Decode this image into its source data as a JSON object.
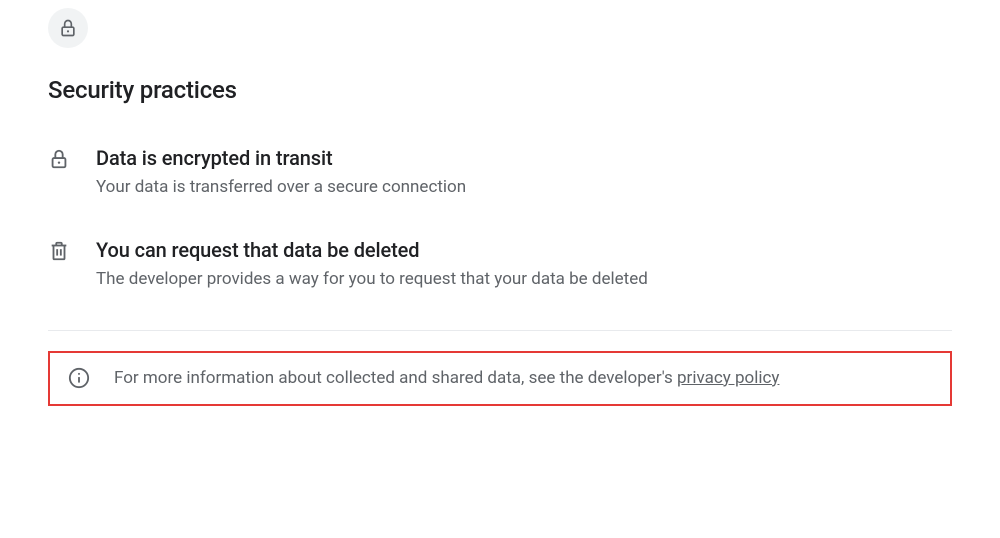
{
  "section": {
    "title": "Security practices"
  },
  "practices": [
    {
      "title": "Data is encrypted in transit",
      "description": "Your data is transferred over a secure connection"
    },
    {
      "title": "You can request that data be deleted",
      "description": "The developer provides a way for you to request that your data be deleted"
    }
  ],
  "info": {
    "text_prefix": "For more information about collected and shared data, see the developer's ",
    "link_text": "privacy policy"
  }
}
